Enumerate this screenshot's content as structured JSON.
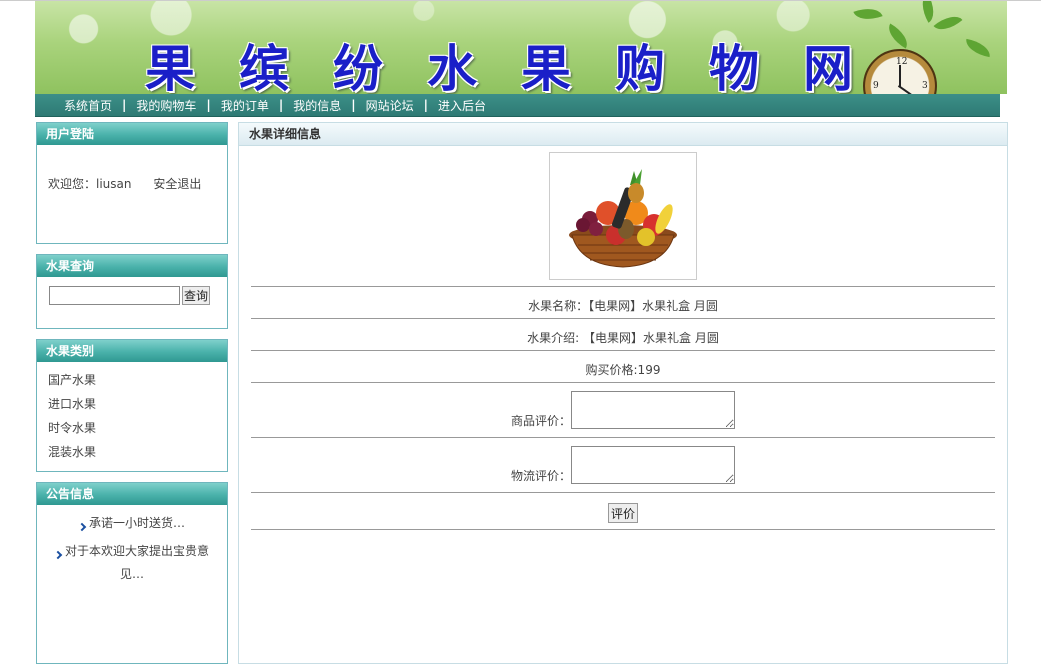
{
  "banner": {
    "title": "果缤纷水果购物网"
  },
  "nav": {
    "items": [
      "系统首页",
      "我的购物车",
      "我的订单",
      "我的信息",
      "网站论坛",
      "进入后台"
    ]
  },
  "login_box": {
    "title": "用户登陆",
    "welcome": "欢迎您：liusan",
    "logout": "安全退出"
  },
  "query_box": {
    "title": "水果查询",
    "input_value": "",
    "button": "查询"
  },
  "category_box": {
    "title": "水果类别",
    "items": [
      "国产水果",
      "进口水果",
      "时令水果",
      "混装水果"
    ]
  },
  "notice_box": {
    "title": "公告信息",
    "items": [
      "承诺一小时送货…",
      "对于本欢迎大家提出宝贵意见…"
    ]
  },
  "detail": {
    "title": "水果详细信息",
    "name": "水果名称：【电果网】水果礼盒 月圆",
    "intro": "水果介绍: 【电果网】水果礼盒 月圆",
    "price": "购买价格:199",
    "product_review_label": "商品评价：",
    "logistics_review_label": "物流评价：",
    "submit": "评价"
  }
}
